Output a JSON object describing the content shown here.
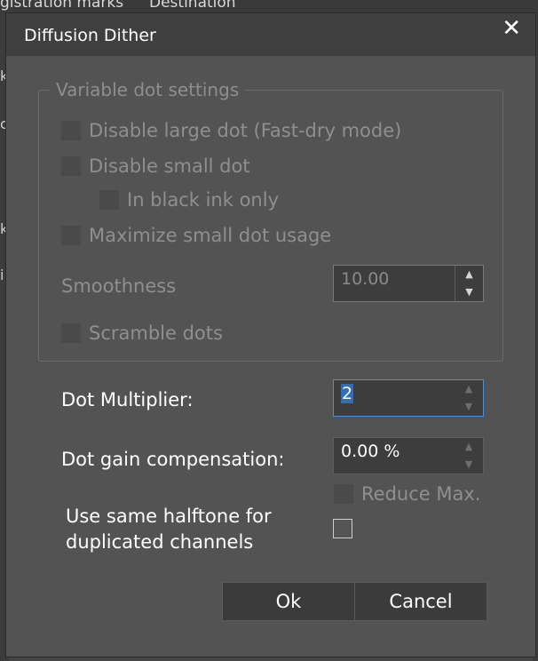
{
  "background": {
    "tabs": [
      "gistration marks",
      "Destination"
    ],
    "left_letters": [
      "k",
      "c",
      "k",
      "i"
    ]
  },
  "dialog": {
    "title": "Diffusion Dither",
    "close_icon": "close-icon",
    "group": {
      "title": "Variable dot settings",
      "disable_large_dot": "Disable large dot (Fast-dry mode)",
      "disable_small_dot": "Disable small dot",
      "black_ink_only": "In black ink only",
      "maximize_small_dot": "Maximize small dot usage",
      "smoothness_label": "Smoothness",
      "smoothness_value": "10.00",
      "scramble_dots": "Scramble dots"
    },
    "dot_multiplier_label": "Dot Multiplier:",
    "dot_multiplier_value": "2",
    "dot_gain_label": "Dot gain compensation:",
    "dot_gain_value": "0.00 %",
    "reduce_max": "Reduce Max.",
    "same_halftone_line1": "Use same halftone for",
    "same_halftone_line2": "duplicated channels",
    "ok_button": "Ok",
    "cancel_button": "Cancel"
  },
  "icons": {
    "spin_up": "▲",
    "spin_down": "▼",
    "close": "✕"
  },
  "colors": {
    "dialog_bg": "#535353",
    "titlebar_bg": "#3f3f3f",
    "focus_border": "#4a8fd6"
  }
}
